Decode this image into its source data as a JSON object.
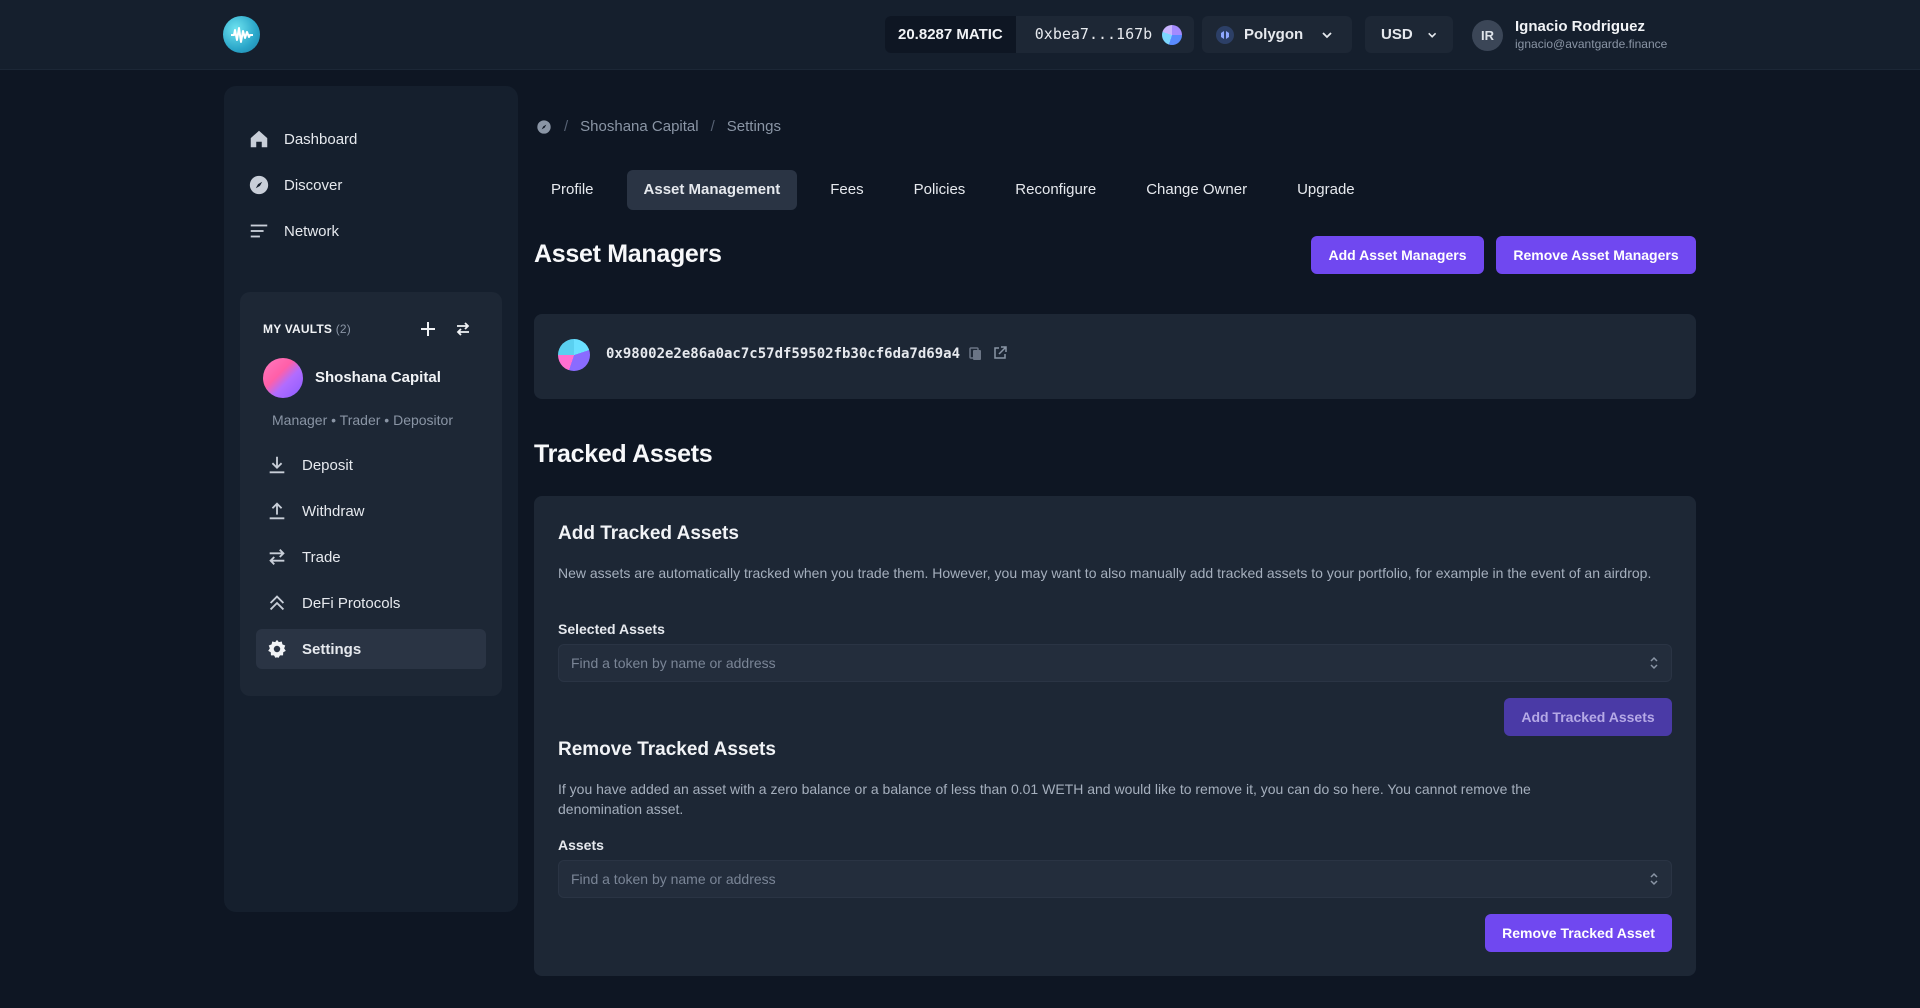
{
  "header": {
    "balance": "20.8287 MATIC",
    "address": "0xbea7...167b",
    "network": "Polygon",
    "currency": "USD",
    "user": {
      "initials": "IR",
      "name": "Ignacio Rodriguez",
      "email": "ignacio@avantgarde.finance"
    }
  },
  "sidebar": {
    "nav": [
      {
        "label": "Dashboard",
        "icon": "home-icon"
      },
      {
        "label": "Discover",
        "icon": "compass-icon"
      },
      {
        "label": "Network",
        "icon": "list-icon"
      }
    ],
    "vaults": {
      "title": "MY VAULTS",
      "count": "(2)",
      "vault_name": "Shoshana Capital",
      "roles": "Manager • Trader • Depositor",
      "items": [
        {
          "label": "Deposit",
          "icon": "download-icon"
        },
        {
          "label": "Withdraw",
          "icon": "upload-icon"
        },
        {
          "label": "Trade",
          "icon": "swap-icon"
        },
        {
          "label": "DeFi Protocols",
          "icon": "chevrons-up-icon"
        },
        {
          "label": "Settings",
          "icon": "gear-icon",
          "active": true
        }
      ]
    }
  },
  "breadcrumb": {
    "vault": "Shoshana Capital",
    "page": "Settings"
  },
  "tabs": [
    {
      "label": "Profile"
    },
    {
      "label": "Asset Management",
      "active": true
    },
    {
      "label": "Fees"
    },
    {
      "label": "Policies"
    },
    {
      "label": "Reconfigure"
    },
    {
      "label": "Change Owner"
    },
    {
      "label": "Upgrade"
    }
  ],
  "asset_managers": {
    "title": "Asset Managers",
    "add_label": "Add Asset Managers",
    "remove_label": "Remove Asset Managers",
    "manager_address": "0x98002e2e86a0ac7c57df59502fb30cf6da7d69a4"
  },
  "tracked_assets": {
    "title": "Tracked Assets",
    "add_section": {
      "title": "Add Tracked Assets",
      "description": "New assets are automatically tracked when you trade them. However, you may want to also manually add tracked assets to your portfolio, for example in the event of an airdrop.",
      "field_label": "Selected Assets",
      "placeholder": "Find a token by name or address",
      "button": "Add Tracked Assets"
    },
    "remove_section": {
      "title": "Remove Tracked Assets",
      "description": "If you have added an asset with a zero balance or a balance of less than 0.01 WETH and would like to remove it, you can do so here. You cannot remove the denomination asset.",
      "field_label": "Assets",
      "placeholder": "Find a token by name or address",
      "button": "Remove Tracked Asset"
    }
  },
  "colors": {
    "accent": "#7048f0",
    "background": "#0e1623",
    "panel": "#151f2d",
    "card": "#1d2735"
  }
}
